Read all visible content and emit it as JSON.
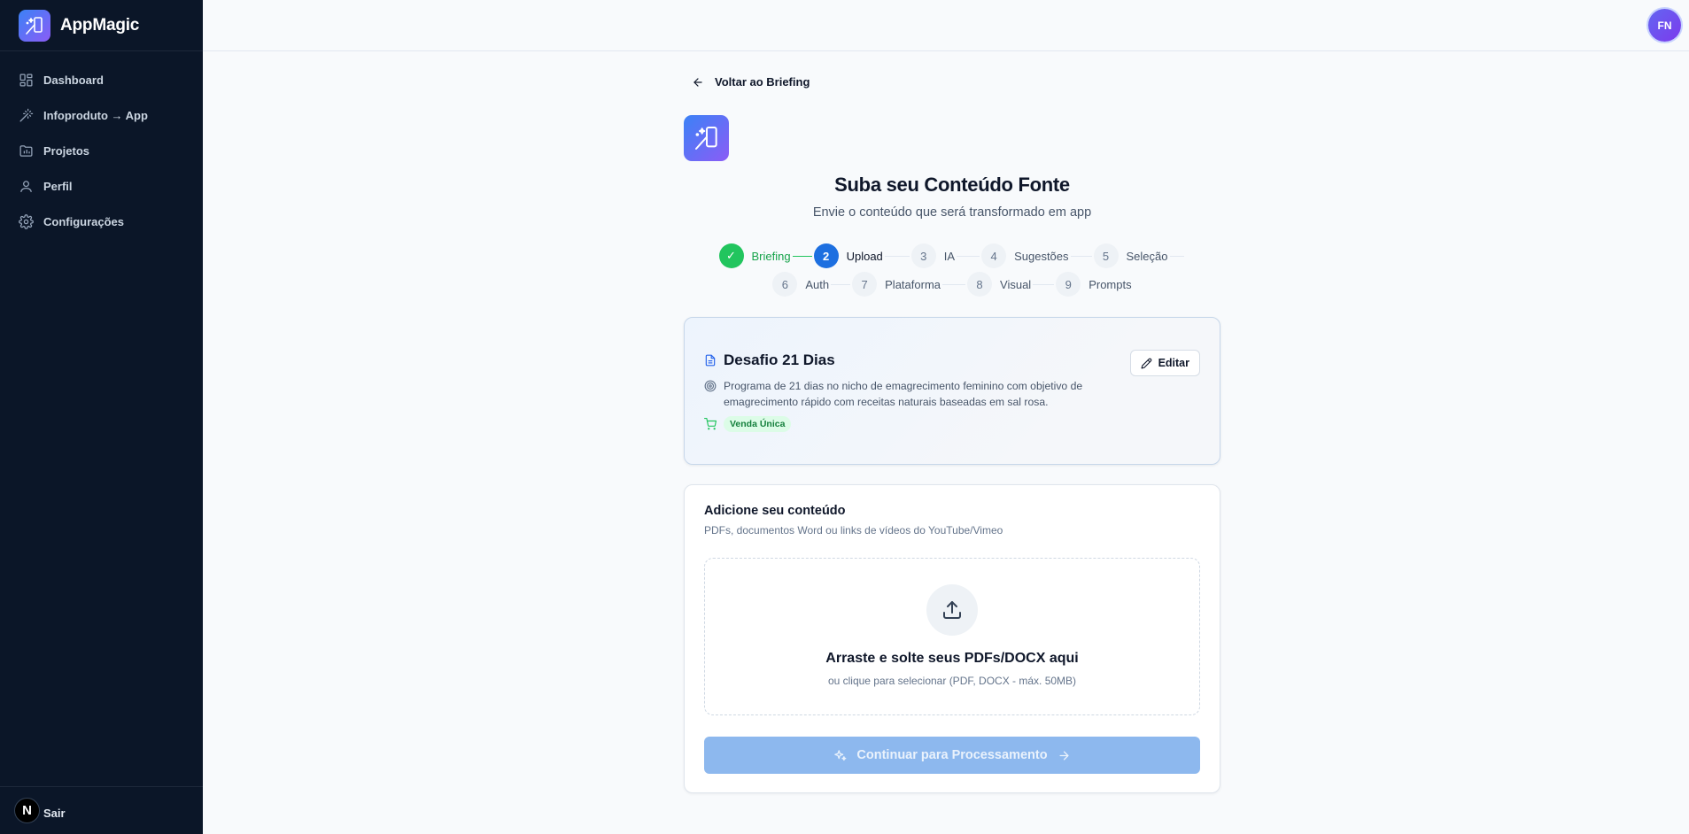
{
  "brand": {
    "name": "AppMagic",
    "logo_icon": "magic-wand-phone-icon"
  },
  "sidebar": {
    "items": [
      {
        "label": "Dashboard",
        "icon": "dashboard-icon"
      },
      {
        "label": "Infoproduto → App",
        "icon": "wand-icon"
      },
      {
        "label": "Projetos",
        "icon": "folder-chart-icon"
      },
      {
        "label": "Perfil",
        "icon": "user-icon"
      },
      {
        "label": "Configurações",
        "icon": "gear-icon"
      }
    ],
    "footer": {
      "avatar_letter": "N",
      "logout_label": "Sair"
    }
  },
  "topbar": {
    "user_initials": "FN"
  },
  "page": {
    "back_label": "Voltar ao Briefing",
    "title": "Suba seu Conteúdo Fonte",
    "subtitle": "Envie o conteúdo que será transformado em app"
  },
  "steps": {
    "row1": [
      {
        "num": "✓",
        "label": "Briefing",
        "state": "done"
      },
      {
        "num": "2",
        "label": "Upload",
        "state": "active"
      },
      {
        "num": "3",
        "label": "IA",
        "state": "pending"
      },
      {
        "num": "4",
        "label": "Sugestões",
        "state": "pending"
      },
      {
        "num": "5",
        "label": "Seleção",
        "state": "pending"
      }
    ],
    "row2": [
      {
        "num": "6",
        "label": "Auth",
        "state": "pending"
      },
      {
        "num": "7",
        "label": "Plataforma",
        "state": "pending"
      },
      {
        "num": "8",
        "label": "Visual",
        "state": "pending"
      },
      {
        "num": "9",
        "label": "Prompts",
        "state": "pending"
      }
    ]
  },
  "briefing": {
    "title": "Desafio 21 Dias",
    "description": "Programa de 21 dias no nicho de emagrecimento feminino com objetivo de emagrecimento rápido com receitas naturais baseadas em sal rosa.",
    "badge": "Venda Única",
    "edit_label": "Editar"
  },
  "upload": {
    "title": "Adicione seu conteúdo",
    "subtitle": "PDFs, documentos Word ou links de vídeos do YouTube/Vimeo",
    "drop_title": "Arraste e solte seus PDFs/DOCX aqui",
    "drop_subtitle": "ou clique para selecionar (PDF, DOCX - máx. 50MB)",
    "continue_label": "Continuar para Processamento"
  },
  "colors": {
    "sidebar_bg": "#0b1628",
    "primary": "#1d6fe0",
    "success": "#22c55e",
    "disabled_button": "#8db8ee"
  }
}
